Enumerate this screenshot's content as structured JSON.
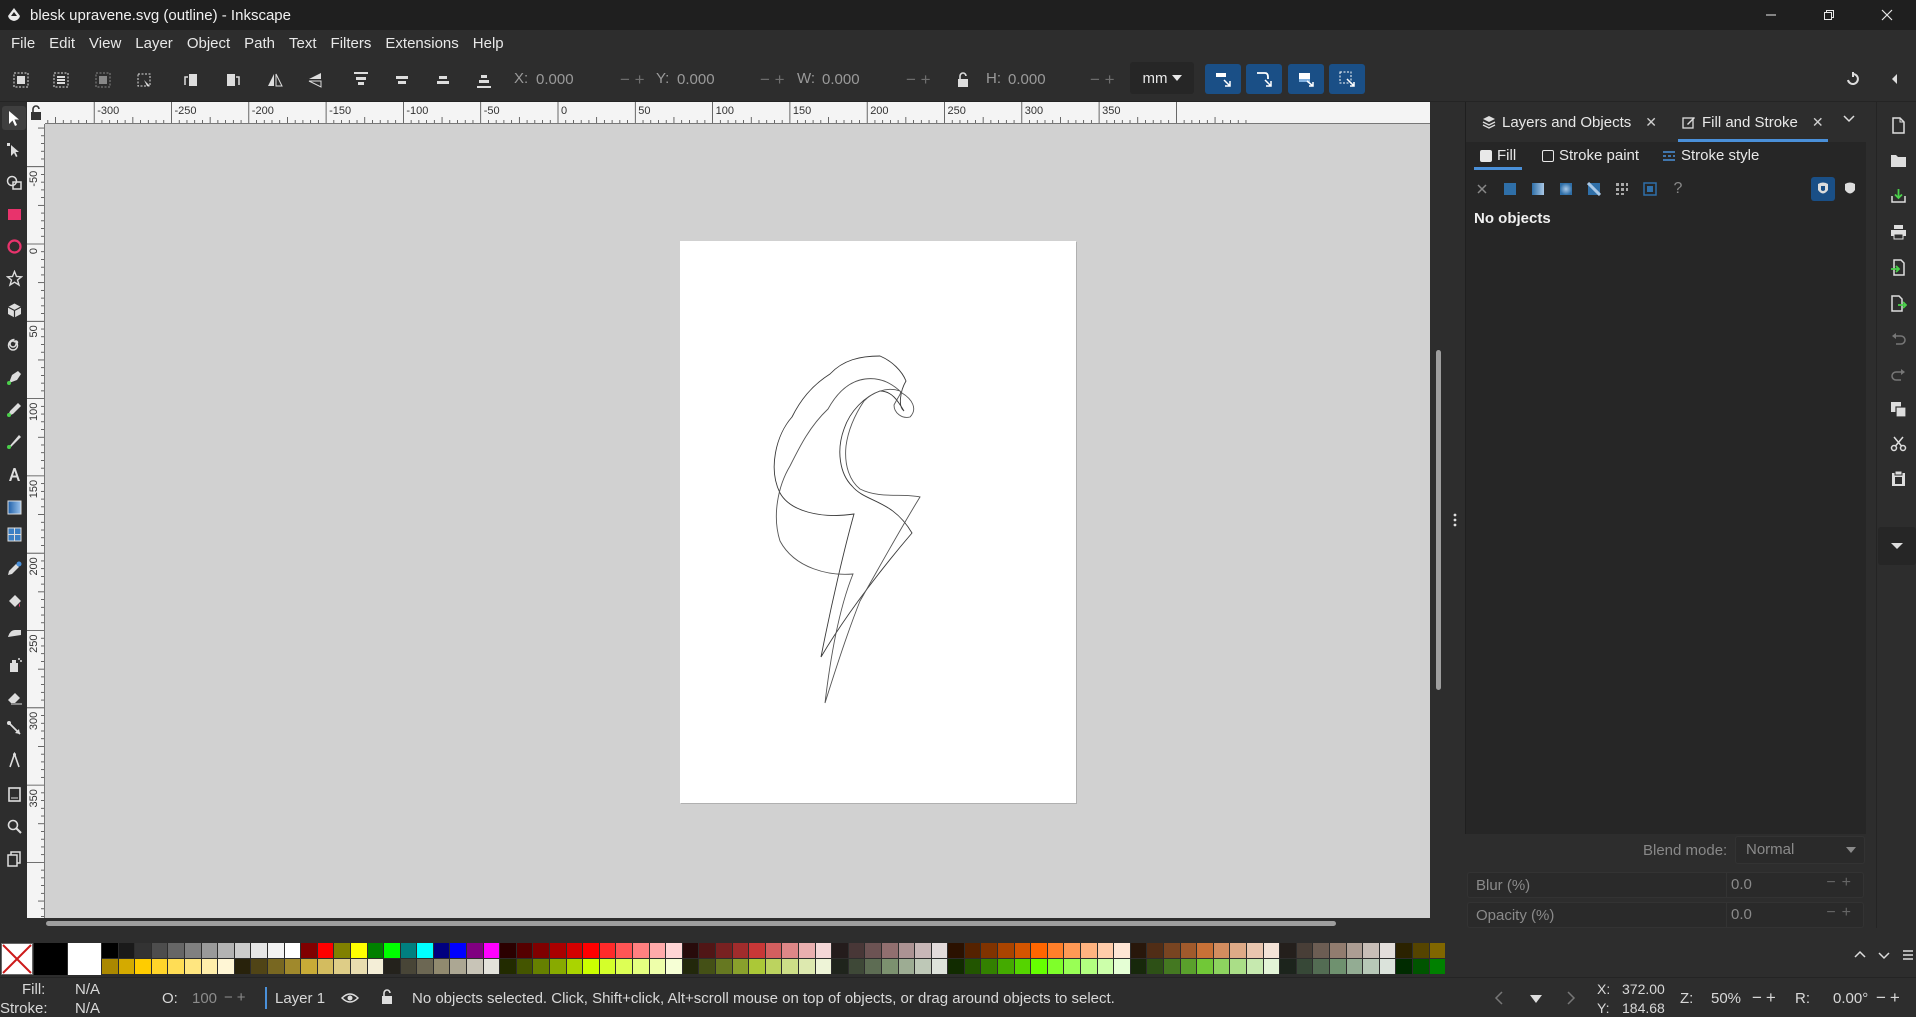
{
  "window": {
    "title": "blesk upravene.svg (outline) - Inkscape",
    "controls": [
      "minimize",
      "restore",
      "close"
    ]
  },
  "menu": [
    "File",
    "Edit",
    "View",
    "Layer",
    "Object",
    "Path",
    "Text",
    "Filters",
    "Extensions",
    "Help"
  ],
  "tool_controls": {
    "x_label": "X:",
    "x_value": "0.000",
    "y_label": "Y:",
    "y_value": "0.000",
    "w_label": "W:",
    "w_value": "0.000",
    "h_label": "H:",
    "h_value": "0.000",
    "unit": "mm"
  },
  "rulers": {
    "horizontal_labels": [
      "-300",
      "-250",
      "-200",
      "-150",
      "-100",
      "-50",
      "0",
      "50",
      "100",
      "150",
      "200",
      "250",
      "300",
      "350"
    ],
    "vertical_labels": [
      "-50",
      "0",
      "50",
      "100",
      "150",
      "200",
      "250",
      "300",
      "350"
    ]
  },
  "dialog": {
    "tabs": [
      {
        "label": "Layers and Objects",
        "icon": "layers-icon"
      },
      {
        "label": "Fill and Stroke",
        "icon": "fill-stroke-icon",
        "active": true
      }
    ],
    "subtabs": [
      {
        "label": "Fill",
        "active": true
      },
      {
        "label": "Stroke paint"
      },
      {
        "label": "Stroke style"
      }
    ],
    "paint_types": [
      "no-paint",
      "flat-color",
      "linear-gradient",
      "radial-gradient",
      "mesh-gradient",
      "pattern",
      "swatch",
      "unset"
    ],
    "message": "No objects",
    "blend_label": "Blend mode:",
    "blend_value": "Normal",
    "blur_label": "Blur (%)",
    "blur_value": "0.0",
    "opacity_label": "Opacity (%)",
    "opacity_value": "0.0"
  },
  "status": {
    "fill_label": "Fill:",
    "fill_value": "N/A",
    "stroke_label": "Stroke:",
    "stroke_value": "N/A",
    "opacity_label": "O:",
    "opacity_value": "100",
    "layer": "Layer 1",
    "message": "No objects selected. Click, Shift+click, Alt+scroll mouse on top of objects, or drag around objects to select.",
    "x_label": "X:",
    "x_value": "372.00",
    "y_label": "Y:",
    "y_value": "184.68",
    "zoom_label": "Z:",
    "zoom_value": "50%",
    "rotate_label": "R:",
    "rotate_value": "0.00°"
  },
  "colors": {
    "accent": "#4a90d9",
    "snap_bg": "#1a4f86",
    "canvas": "#d1d1d1",
    "ui_bg": "#2d2d2d"
  },
  "palette_top": [
    "#000000",
    "#1a1a1a",
    "#333333",
    "#4d4d4d",
    "#666666",
    "#808080",
    "#999999",
    "#b3b3b3",
    "#cccccc",
    "#e6e6e6",
    "#f2f2f2",
    "#ffffff",
    "#800000",
    "#ff0000",
    "#808000",
    "#ffff00",
    "#008000",
    "#00ff00",
    "#008080",
    "#00ffff",
    "#000080",
    "#0000ff",
    "#800080",
    "#ff00ff",
    "#2b0000",
    "#550000",
    "#800000",
    "#aa0000",
    "#d40000",
    "#ff0000",
    "#ff2a2a",
    "#ff5555",
    "#ff8080",
    "#ffaaaa",
    "#ffd5d5",
    "#280b0b",
    "#501616",
    "#782121",
    "#a02c2c",
    "#c83737",
    "#d35f5f",
    "#de8787",
    "#e9afaf",
    "#f4d7d7",
    "#241c1c",
    "#483737",
    "#6c5353",
    "#916f6f",
    "#ac9393",
    "#c8b7b7",
    "#e3dbdb",
    "#2b1100",
    "#552200",
    "#803300",
    "#aa4400",
    "#d45500",
    "#ff6600",
    "#ff7f2a",
    "#ff9955",
    "#ffb380",
    "#ffccaa",
    "#ffe6d5",
    "#28170b",
    "#502d16",
    "#784421",
    "#a05a2c",
    "#c87137",
    "#d38d5f",
    "#deaa87",
    "#e9c6af",
    "#f4e3d7",
    "#241f1c",
    "#483e37",
    "#6c5d53",
    "#917c6f",
    "#ac9d93",
    "#c8beb7",
    "#e3dedb",
    "#2b2200",
    "#554400",
    "#806600"
  ],
  "palette_bottom": [
    "#aa8800",
    "#d4aa00",
    "#ffcc00",
    "#ffd42a",
    "#ffdd55",
    "#ffe680",
    "#ffeeaa",
    "#fff6d5",
    "#28220b",
    "#504416",
    "#786721",
    "#a0892c",
    "#c8ab37",
    "#d3bc5f",
    "#decd87",
    "#e9ddaf",
    "#f4eed7",
    "#24221c",
    "#484537",
    "#6c6753",
    "#918a6f",
    "#aca793",
    "#c8c4b7",
    "#e3e2db",
    "#222b00",
    "#445500",
    "#668000",
    "#88aa00",
    "#aad400",
    "#ccff00",
    "#d4ff2a",
    "#ddff55",
    "#e5ff80",
    "#eeffaa",
    "#f6ffd5",
    "#22280b",
    "#445016",
    "#667821",
    "#89a02c",
    "#abc837",
    "#bcd35f",
    "#cdde87",
    "#dde9af",
    "#eef4d7",
    "#1f241c",
    "#3e4837",
    "#5d6c53",
    "#7c916f",
    "#9dac93",
    "#bec8b7",
    "#dee3db",
    "#112b00",
    "#225500",
    "#338000",
    "#44aa00",
    "#55d400",
    "#66ff00",
    "#7fff2a",
    "#99ff55",
    "#b3ff80",
    "#ccffaa",
    "#e5ffd5",
    "#17280b",
    "#2d5016",
    "#447821",
    "#5aa02c",
    "#71c837",
    "#8dd35f",
    "#aade87",
    "#c6e9af",
    "#e3f4d7",
    "#1c241c",
    "#374837",
    "#536c53",
    "#6f916f",
    "#93ac93",
    "#b7c8b7",
    "#dbe3db",
    "#002b00",
    "#005500",
    "#008000"
  ]
}
